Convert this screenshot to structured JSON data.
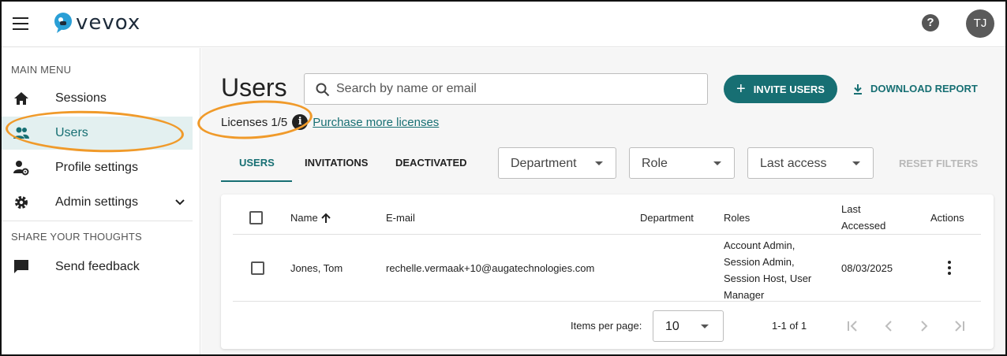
{
  "header": {
    "logo_text": "vevox",
    "help_icon": "?",
    "avatar_initials": "TJ"
  },
  "sidebar": {
    "main_menu_title": "MAIN MENU",
    "items": [
      {
        "label": "Sessions",
        "icon": "home-icon"
      },
      {
        "label": "Users",
        "icon": "users-icon",
        "active": true
      },
      {
        "label": "Profile settings",
        "icon": "profile-settings-icon"
      },
      {
        "label": "Admin settings",
        "icon": "gear-icon"
      }
    ],
    "share_title": "SHARE YOUR THOUGHTS",
    "feedback_label": "Send feedback"
  },
  "main": {
    "title": "Users",
    "search_placeholder": "Search by name or email",
    "invite_label": "INVITE USERS",
    "download_label": "DOWNLOAD REPORT",
    "licenses_text": "Licenses 1/5",
    "info_icon": "i",
    "purchase_link": "Purchase more licenses",
    "tabs": [
      "USERS",
      "INVITATIONS",
      "DEACTIVATED"
    ],
    "filters": [
      "Department",
      "Role",
      "Last access"
    ],
    "reset_label": "RESET FILTERS"
  },
  "table": {
    "headers": {
      "name": "Name",
      "email": "E-mail",
      "department": "Department",
      "roles": "Roles",
      "last_accessed_1": "Last",
      "last_accessed_2": "Accessed",
      "actions": "Actions"
    },
    "rows": [
      {
        "name": "Jones, Tom",
        "email": "rechelle.vermaak+10@augatechnologies.com",
        "department": "",
        "roles": [
          "Account Admin,",
          "Session Admin,",
          "Session Host, User",
          "Manager"
        ],
        "last_accessed": "08/03/2025"
      }
    ],
    "items_per_page_label": "Items per page:",
    "items_per_page": "10",
    "range": "1-1 of 1"
  },
  "colors": {
    "accent": "#176f73",
    "annotation": "#f09a2a"
  }
}
